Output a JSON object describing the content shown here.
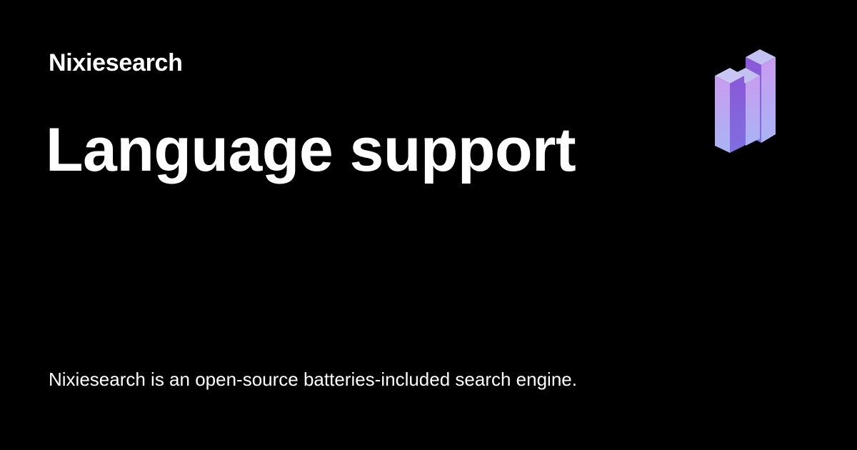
{
  "site": {
    "name": "Nixiesearch"
  },
  "page": {
    "title": "Language support",
    "description": "Nixiesearch is an open-source batteries-included search engine."
  },
  "logo": {
    "icon": "nixiesearch-logo-icon",
    "colors": {
      "top": "#b9b6f0",
      "light": "#c79bf0",
      "dark": "#7b52d6",
      "bottom": "#a9b0f2"
    }
  },
  "theme": {
    "background": "#000000",
    "text": "#ffffff"
  }
}
